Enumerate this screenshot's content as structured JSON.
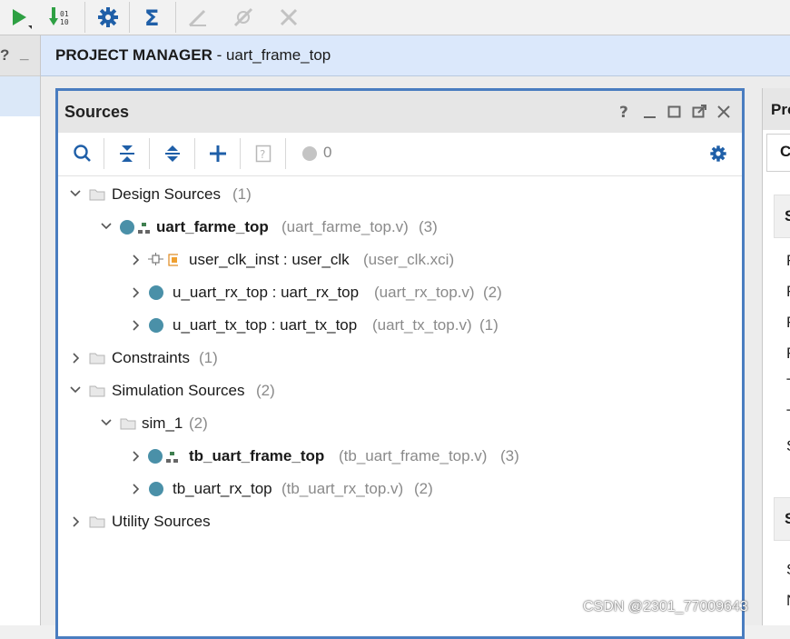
{
  "header": {
    "title_bold": "PROJECT MANAGER",
    "title_rest": " - uart_frame_top"
  },
  "left_strip": {
    "help": "?",
    "minimize": "_"
  },
  "sources": {
    "title": "Sources",
    "controls": [
      "?",
      "_",
      "maximize",
      "float",
      "close"
    ],
    "toolbar": {
      "icons": [
        "search-icon",
        "collapse-all-icon",
        "expand-all-icon",
        "add-icon",
        "unknown-file-icon",
        "status-dot-icon",
        "gear-icon"
      ],
      "count": "0"
    },
    "tree": [
      {
        "id": "design",
        "label": "Design Sources",
        "count": "(1)"
      },
      {
        "id": "uart_farme_top",
        "label": "uart_farme_top",
        "file": "(uart_farme_top.v)",
        "count": "(3)"
      },
      {
        "id": "user_clk_inst",
        "label": "user_clk_inst : user_clk",
        "file": "(user_clk.xci)"
      },
      {
        "id": "u_uart_rx_top",
        "label": "u_uart_rx_top : uart_rx_top",
        "file": "(uart_rx_top.v)",
        "count": "(2)"
      },
      {
        "id": "u_uart_tx_top",
        "label": "u_uart_tx_top : uart_tx_top",
        "file": "(uart_tx_top.v)",
        "count": "(1)"
      },
      {
        "id": "constraints",
        "label": "Constraints",
        "count": "(1)"
      },
      {
        "id": "simulation",
        "label": "Simulation Sources",
        "count": "(2)"
      },
      {
        "id": "sim_1",
        "label": "sim_1",
        "count": "(2)"
      },
      {
        "id": "tb_uart_frame_top",
        "label": "tb_uart_frame_top",
        "file": "(tb_uart_frame_top.v)",
        "count": "(3)"
      },
      {
        "id": "tb_uart_rx_top",
        "label": "tb_uart_rx_top",
        "file": "(tb_uart_rx_top.v)",
        "count": "(2)"
      },
      {
        "id": "utility",
        "label": "Utility Sources"
      }
    ]
  },
  "right_panel": {
    "title": "Pro",
    "tab": "C",
    "section_heads": [
      "S",
      "S"
    ],
    "items": [
      "F",
      "F",
      "F",
      "F",
      "T",
      "T",
      "S",
      "S",
      "N"
    ]
  },
  "colors": {
    "accent_border": "#4a7dc0",
    "pm_bar": "#dbe8fb",
    "node_dot": "#4a90a8",
    "run_green": "#2ea043",
    "gear_blue": "#1f5fa8"
  },
  "watermark": "CSDN @2301_77009643"
}
